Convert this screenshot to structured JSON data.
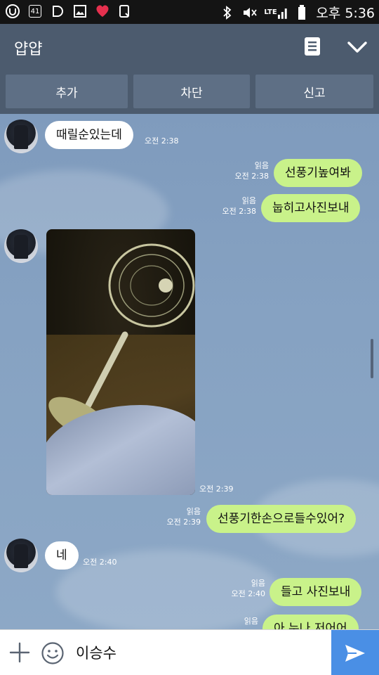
{
  "status_bar": {
    "time": "오후 5:36",
    "network": "LTE",
    "left_icons": [
      "app-u-icon",
      "alarm-41-icon",
      "d-app-icon",
      "gallery-icon",
      "heart-icon",
      "clipboard-icon"
    ],
    "alarm_badge": "41"
  },
  "header": {
    "title": "얍얍",
    "menu_icon": "menu-icon",
    "collapse_icon": "chevron-down-icon"
  },
  "actions": {
    "add": "추가",
    "block": "차단",
    "report": "신고"
  },
  "messages": [
    {
      "side": "in",
      "text": "때릴순있는데",
      "time": "오전 2:38"
    },
    {
      "side": "out",
      "text": "선풍기높여봐",
      "read": "읽음",
      "time": "오전 2:38"
    },
    {
      "side": "out",
      "text": "눕히고사진보내",
      "read": "읽음",
      "time": "오전 2:38"
    },
    {
      "side": "in",
      "type": "photo",
      "time": "오전 2:39"
    },
    {
      "side": "out",
      "text": "선풍기한손으로들수있어?",
      "read": "읽음",
      "time": "오전 2:39"
    },
    {
      "side": "in",
      "text": "네",
      "time": "오전 2:40"
    },
    {
      "side": "out",
      "text": "들고 사진보내",
      "read": "읽음",
      "time": "오전 2:40"
    },
    {
      "side": "out",
      "text": "아  누나 저어어",
      "read": "읽음",
      "time": ""
    }
  ],
  "input": {
    "value": "이승수",
    "plus_icon": "plus-icon",
    "emoji_icon": "emoji-icon",
    "send_icon": "send-icon"
  },
  "colors": {
    "header": "#4c5b6e",
    "chat_background": "#7f9bbd",
    "outgoing_bubble": "#c9f28a",
    "incoming_bubble": "#ffffff",
    "send_button": "#4a8fe5"
  }
}
